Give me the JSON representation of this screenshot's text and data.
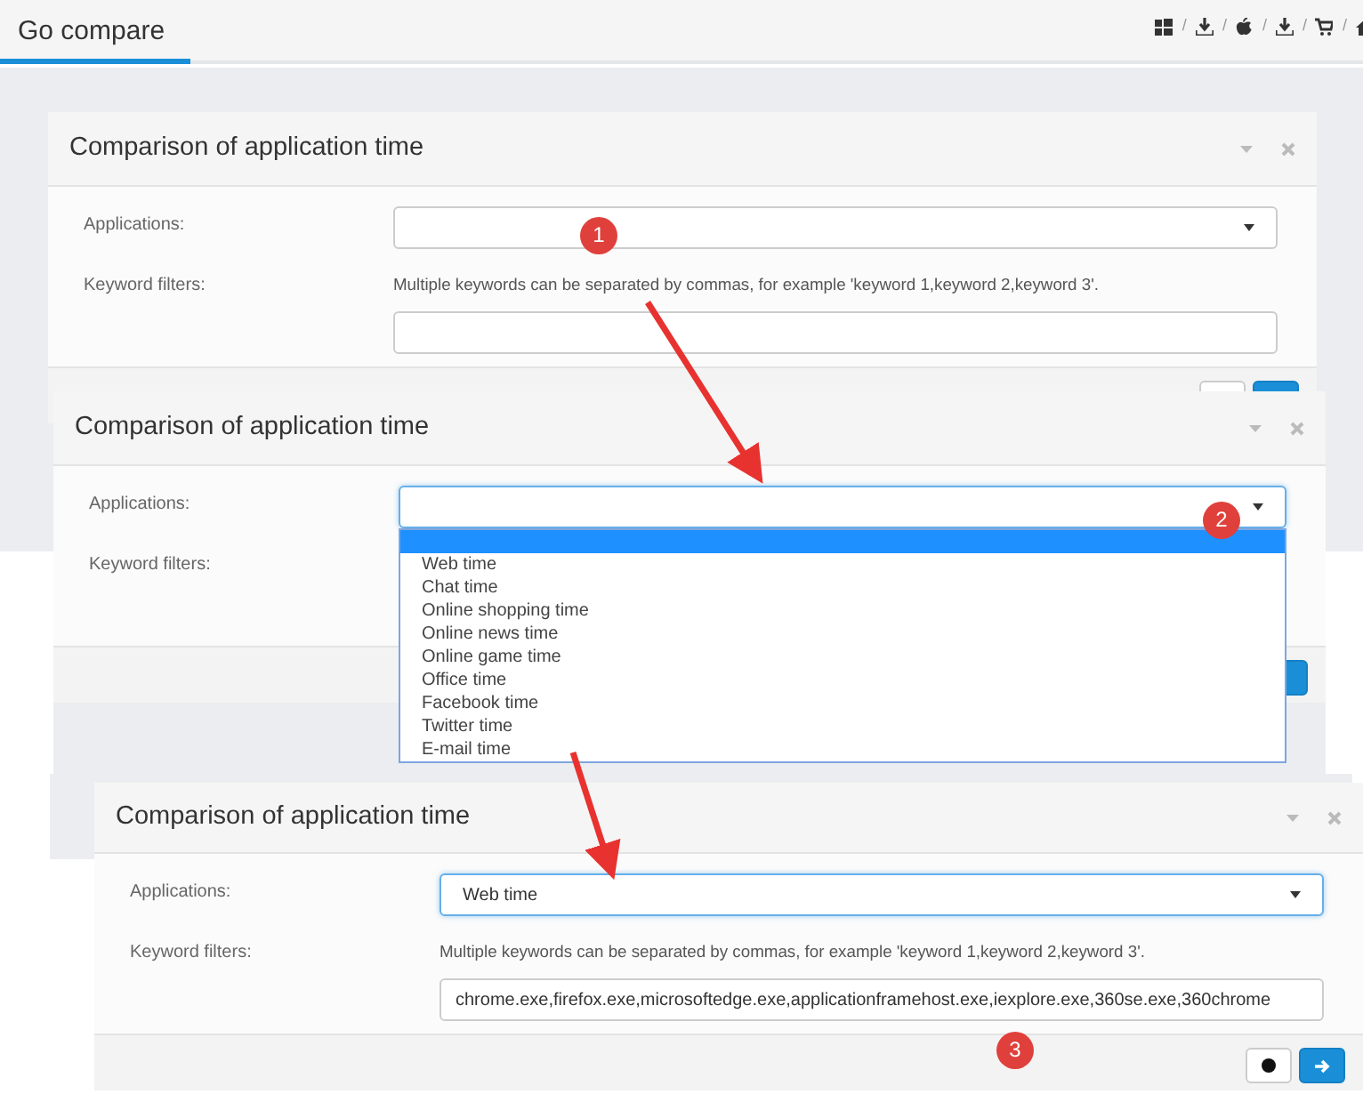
{
  "top_bar": {
    "tab": {
      "label": "Go compare",
      "selected": true
    },
    "separators": [
      "/",
      "/",
      "/",
      "/",
      "/"
    ]
  },
  "panels": [
    {
      "title": "Comparison of application time",
      "applications_label": "Applications:",
      "select": {
        "focused": false
      },
      "keyword_label": "Keyword filters:",
      "keyword_help": "Multiple keywords can be separated by commas, for example 'keyword 1,keyword 2,keyword 3'.",
      "keyword_field": {
        "focused": false
      }
    },
    {
      "title": "Comparison of application time",
      "applications_label": "Applications:",
      "select": {
        "focused": true
      },
      "keyword_label": "Keyword filters:",
      "dropdown": {
        "blank_option_highlighted": true,
        "options": [
          {
            "label": "Web time",
            "selected": false
          },
          {
            "label": "Chat time",
            "selected": false
          },
          {
            "label": "Online shopping time",
            "selected": false
          },
          {
            "label": "Online news time",
            "selected": false
          },
          {
            "label": "Online game time",
            "selected": false
          },
          {
            "label": "Office time",
            "selected": false
          },
          {
            "label": "Facebook time",
            "selected": false
          },
          {
            "label": "Twitter time",
            "selected": false
          },
          {
            "label": "E-mail time",
            "selected": false
          }
        ]
      }
    },
    {
      "title": "Comparison of application time",
      "applications_label": "Applications:",
      "select": {
        "focused": true,
        "value": "Web time"
      },
      "keyword_label": "Keyword filters:",
      "keyword_help": "Multiple keywords can be separated by commas, for example 'keyword 1,keyword 2,keyword 3'.",
      "keyword_field": {
        "focused": false,
        "value": "chrome.exe,firefox.exe,microsoftedge.exe,applicationframehost.exe,iexplore.exe,360se.exe,360chrome"
      }
    }
  ],
  "annotations": [
    {
      "label": "1"
    },
    {
      "label": "2"
    },
    {
      "label": "3"
    }
  ]
}
